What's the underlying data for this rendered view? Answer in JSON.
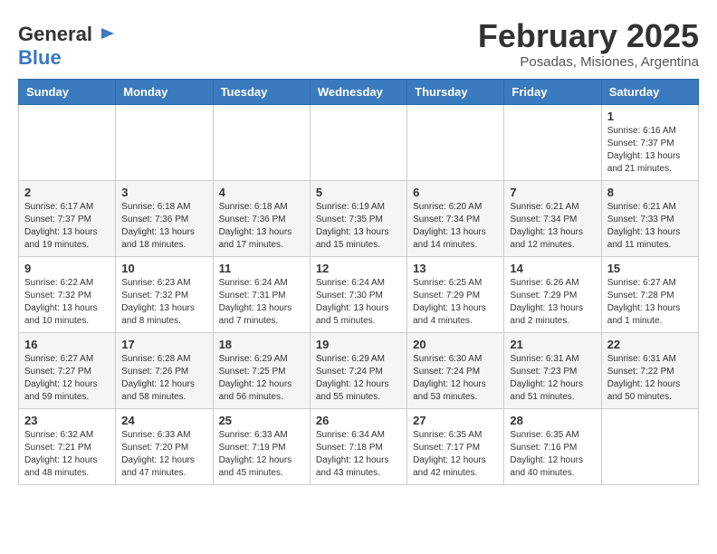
{
  "header": {
    "logo_line1": "General",
    "logo_line2": "Blue",
    "month": "February 2025",
    "location": "Posadas, Misiones, Argentina"
  },
  "weekdays": [
    "Sunday",
    "Monday",
    "Tuesday",
    "Wednesday",
    "Thursday",
    "Friday",
    "Saturday"
  ],
  "weeks": [
    [
      {
        "day": "",
        "info": ""
      },
      {
        "day": "",
        "info": ""
      },
      {
        "day": "",
        "info": ""
      },
      {
        "day": "",
        "info": ""
      },
      {
        "day": "",
        "info": ""
      },
      {
        "day": "",
        "info": ""
      },
      {
        "day": "1",
        "info": "Sunrise: 6:16 AM\nSunset: 7:37 PM\nDaylight: 13 hours\nand 21 minutes."
      }
    ],
    [
      {
        "day": "2",
        "info": "Sunrise: 6:17 AM\nSunset: 7:37 PM\nDaylight: 13 hours\nand 19 minutes."
      },
      {
        "day": "3",
        "info": "Sunrise: 6:18 AM\nSunset: 7:36 PM\nDaylight: 13 hours\nand 18 minutes."
      },
      {
        "day": "4",
        "info": "Sunrise: 6:18 AM\nSunset: 7:36 PM\nDaylight: 13 hours\nand 17 minutes."
      },
      {
        "day": "5",
        "info": "Sunrise: 6:19 AM\nSunset: 7:35 PM\nDaylight: 13 hours\nand 15 minutes."
      },
      {
        "day": "6",
        "info": "Sunrise: 6:20 AM\nSunset: 7:34 PM\nDaylight: 13 hours\nand 14 minutes."
      },
      {
        "day": "7",
        "info": "Sunrise: 6:21 AM\nSunset: 7:34 PM\nDaylight: 13 hours\nand 12 minutes."
      },
      {
        "day": "8",
        "info": "Sunrise: 6:21 AM\nSunset: 7:33 PM\nDaylight: 13 hours\nand 11 minutes."
      }
    ],
    [
      {
        "day": "9",
        "info": "Sunrise: 6:22 AM\nSunset: 7:32 PM\nDaylight: 13 hours\nand 10 minutes."
      },
      {
        "day": "10",
        "info": "Sunrise: 6:23 AM\nSunset: 7:32 PM\nDaylight: 13 hours\nand 8 minutes."
      },
      {
        "day": "11",
        "info": "Sunrise: 6:24 AM\nSunset: 7:31 PM\nDaylight: 13 hours\nand 7 minutes."
      },
      {
        "day": "12",
        "info": "Sunrise: 6:24 AM\nSunset: 7:30 PM\nDaylight: 13 hours\nand 5 minutes."
      },
      {
        "day": "13",
        "info": "Sunrise: 6:25 AM\nSunset: 7:29 PM\nDaylight: 13 hours\nand 4 minutes."
      },
      {
        "day": "14",
        "info": "Sunrise: 6:26 AM\nSunset: 7:29 PM\nDaylight: 13 hours\nand 2 minutes."
      },
      {
        "day": "15",
        "info": "Sunrise: 6:27 AM\nSunset: 7:28 PM\nDaylight: 13 hours\nand 1 minute."
      }
    ],
    [
      {
        "day": "16",
        "info": "Sunrise: 6:27 AM\nSunset: 7:27 PM\nDaylight: 12 hours\nand 59 minutes."
      },
      {
        "day": "17",
        "info": "Sunrise: 6:28 AM\nSunset: 7:26 PM\nDaylight: 12 hours\nand 58 minutes."
      },
      {
        "day": "18",
        "info": "Sunrise: 6:29 AM\nSunset: 7:25 PM\nDaylight: 12 hours\nand 56 minutes."
      },
      {
        "day": "19",
        "info": "Sunrise: 6:29 AM\nSunset: 7:24 PM\nDaylight: 12 hours\nand 55 minutes."
      },
      {
        "day": "20",
        "info": "Sunrise: 6:30 AM\nSunset: 7:24 PM\nDaylight: 12 hours\nand 53 minutes."
      },
      {
        "day": "21",
        "info": "Sunrise: 6:31 AM\nSunset: 7:23 PM\nDaylight: 12 hours\nand 51 minutes."
      },
      {
        "day": "22",
        "info": "Sunrise: 6:31 AM\nSunset: 7:22 PM\nDaylight: 12 hours\nand 50 minutes."
      }
    ],
    [
      {
        "day": "23",
        "info": "Sunrise: 6:32 AM\nSunset: 7:21 PM\nDaylight: 12 hours\nand 48 minutes."
      },
      {
        "day": "24",
        "info": "Sunrise: 6:33 AM\nSunset: 7:20 PM\nDaylight: 12 hours\nand 47 minutes."
      },
      {
        "day": "25",
        "info": "Sunrise: 6:33 AM\nSunset: 7:19 PM\nDaylight: 12 hours\nand 45 minutes."
      },
      {
        "day": "26",
        "info": "Sunrise: 6:34 AM\nSunset: 7:18 PM\nDaylight: 12 hours\nand 43 minutes."
      },
      {
        "day": "27",
        "info": "Sunrise: 6:35 AM\nSunset: 7:17 PM\nDaylight: 12 hours\nand 42 minutes."
      },
      {
        "day": "28",
        "info": "Sunrise: 6:35 AM\nSunset: 7:16 PM\nDaylight: 12 hours\nand 40 minutes."
      },
      {
        "day": "",
        "info": ""
      }
    ]
  ]
}
